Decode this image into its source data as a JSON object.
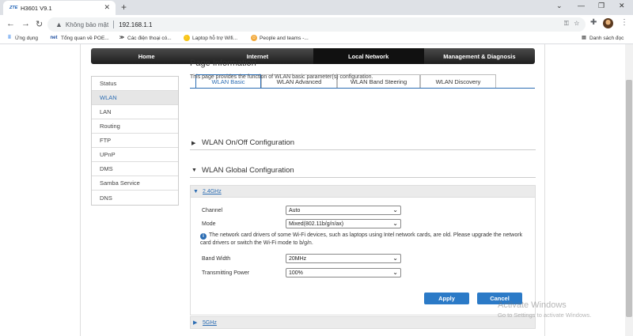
{
  "browser": {
    "tab_title": "H3601 V9.1",
    "tab_logo": "ZTE",
    "security_label": "Không bảo mật",
    "url": "192.168.1.1",
    "bookmarks": [
      {
        "icon": "apps-grid-icon",
        "label": "Ứng dụng"
      },
      {
        "icon": "net-icon",
        "label": "Tổng quan về POE..."
      },
      {
        "icon": "tgdd-icon",
        "label": "Các điện thoại có..."
      },
      {
        "icon": "lightning-icon",
        "label": "Laptop hỗ trợ Wifi..."
      },
      {
        "icon": "teams-icon",
        "label": "People and teams -..."
      }
    ],
    "reading_list_label": "Danh sách đọc"
  },
  "main_nav": [
    "Home",
    "Internet",
    "Local Network",
    "Management & Diagnosis"
  ],
  "main_nav_active": "Local Network",
  "side_menu": [
    "Status",
    "WLAN",
    "LAN",
    "Routing",
    "FTP",
    "UPnP",
    "DMS",
    "Samba Service",
    "DNS"
  ],
  "side_menu_active": "WLAN",
  "sub_tabs": [
    "WLAN Basic",
    "WLAN Advanced",
    "WLAN Band Steering",
    "WLAN Discovery"
  ],
  "sub_tab_active": "WLAN Basic",
  "page": {
    "title": "Page Information",
    "description": "This page provides the function of WLAN basic parameter(s) configuration."
  },
  "sections": {
    "onoff": "WLAN On/Off Configuration",
    "global": "WLAN Global Configuration"
  },
  "band_24": {
    "label": "2.4GHz",
    "channel_label": "Channel",
    "channel_value": "Auto",
    "mode_label": "Mode",
    "mode_value": "Mixed(802.11b/g/n/ax)",
    "info_text": "The network card drivers of some Wi-Fi devices, such as laptops using Intel network cards, are old. Please upgrade the network card drivers or switch the Wi-Fi mode to b/g/n.",
    "bandwidth_label": "Band Width",
    "bandwidth_value": "20MHz",
    "power_label": "Transmitting Power",
    "power_value": "100%",
    "apply_label": "Apply",
    "cancel_label": "Cancel"
  },
  "band_5": {
    "label": "5GHz"
  },
  "watermark": {
    "line1": "Activate Windows",
    "line2": "Go to Settings to activate Windows."
  },
  "colors": {
    "accent": "#2c6db3",
    "button": "#2b7ac7",
    "nav_dark": "#1e1e1e"
  }
}
